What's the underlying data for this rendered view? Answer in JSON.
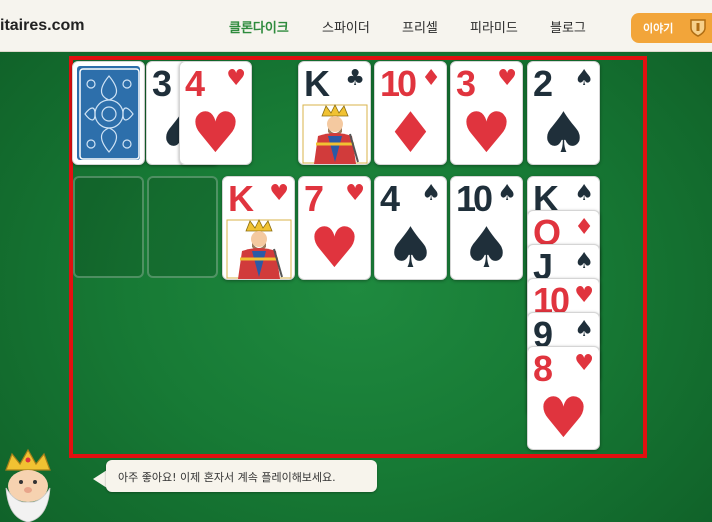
{
  "header": {
    "site_name": "itaires.com",
    "nav": [
      {
        "label": "클론다이크",
        "active": true
      },
      {
        "label": "스파이더",
        "active": false
      },
      {
        "label": "프리셀",
        "active": false
      },
      {
        "label": "피라미드",
        "active": false
      },
      {
        "label": "블로그",
        "active": false
      }
    ],
    "story_button": "이야기"
  },
  "colors": {
    "felt": "#177a35",
    "highlight_border": "#e11010",
    "nav_active": "#2e8b3d",
    "story_button": "#f2a53a",
    "red_suit": "#e0343e",
    "black_suit": "#1f2f3a"
  },
  "game": {
    "stock": {
      "face_down": true
    },
    "waste": [
      {
        "rank": "3",
        "suit": "♠",
        "color": "black"
      },
      {
        "rank": "4",
        "suit": "♥",
        "color": "red"
      }
    ],
    "foundations": [
      {
        "rank": "K",
        "suit": "♣",
        "color": "black"
      },
      {
        "rank": "10",
        "suit": "♦",
        "color": "red"
      },
      {
        "rank": "3",
        "suit": "♥",
        "color": "red"
      },
      {
        "rank": "2",
        "suit": "♠",
        "color": "black"
      }
    ],
    "tableau": [
      {
        "cards": []
      },
      {
        "cards": []
      },
      {
        "cards": [
          {
            "rank": "K",
            "suit": "♥",
            "color": "red"
          }
        ]
      },
      {
        "cards": [
          {
            "rank": "7",
            "suit": "♥",
            "color": "red"
          }
        ]
      },
      {
        "cards": [
          {
            "rank": "4",
            "suit": "♠",
            "color": "black"
          }
        ]
      },
      {
        "cards": [
          {
            "rank": "10",
            "suit": "♠",
            "color": "black"
          }
        ]
      },
      {
        "cards": [
          {
            "rank": "K",
            "suit": "♠",
            "color": "black"
          },
          {
            "rank": "Q",
            "suit": "♦",
            "color": "red"
          },
          {
            "rank": "J",
            "suit": "♠",
            "color": "black"
          },
          {
            "rank": "10",
            "suit": "♥",
            "color": "red"
          },
          {
            "rank": "9",
            "suit": "♠",
            "color": "black"
          },
          {
            "rank": "8",
            "suit": "♥",
            "color": "red"
          }
        ]
      }
    ]
  },
  "message": "아주 좋아요! 이제 혼자서 계속 플레이해보세요."
}
